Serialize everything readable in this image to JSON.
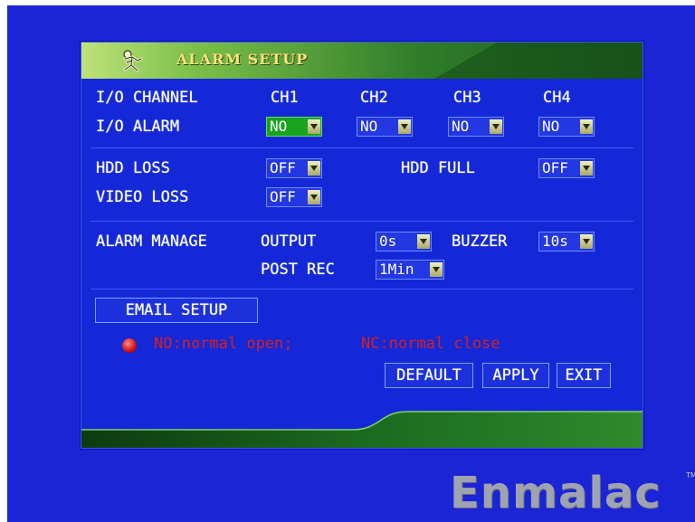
{
  "window": {
    "title": "ALARM SETUP",
    "icon": "alarm-person-icon"
  },
  "io": {
    "channel_label": "I/O CHANNEL",
    "alarm_label": "I/O ALARM",
    "channels": [
      {
        "name": "CH1",
        "value": "NO"
      },
      {
        "name": "CH2",
        "value": "NO"
      },
      {
        "name": "CH3",
        "value": "NO"
      },
      {
        "name": "CH4",
        "value": "NO"
      }
    ]
  },
  "hdd": {
    "loss_label": "HDD LOSS",
    "loss_value": "OFF",
    "full_label": "HDD FULL",
    "full_value": "OFF",
    "video_loss_label": "VIDEO LOSS",
    "video_loss_value": "OFF"
  },
  "alarm_manage": {
    "label": "ALARM MANAGE",
    "output_label": "OUTPUT",
    "output_value": "0s",
    "buzzer_label": "BUZZER",
    "buzzer_value": "10s",
    "post_rec_label": "POST REC",
    "post_rec_value": "1Min"
  },
  "email_button": "EMAIL SETUP",
  "legend": {
    "no_text": "NO:normal open;",
    "nc_text": "NC:normal close"
  },
  "buttons": {
    "default": "DEFAULT",
    "apply": "APPLY",
    "exit": "EXIT"
  },
  "watermark": {
    "brand": "Enmalac",
    "tm": "TM"
  },
  "colors": {
    "screen_bg": "#1c25d6",
    "focus_green": "#19a31f",
    "legend_red": "#d81f1f"
  }
}
